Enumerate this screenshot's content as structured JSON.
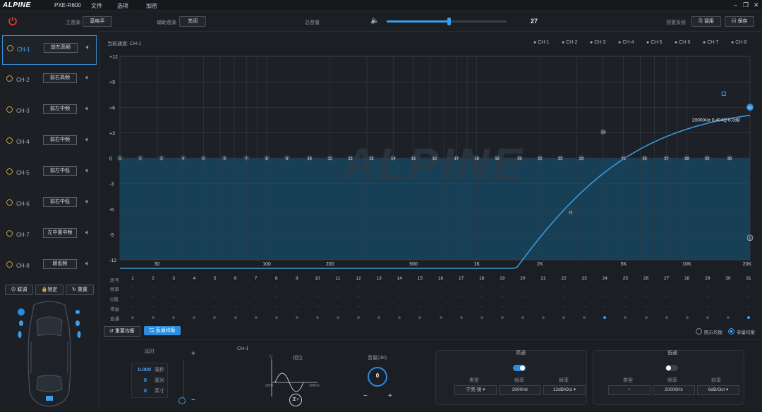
{
  "app": {
    "logo": "ALPINE",
    "model": "PXE-R600"
  },
  "menu": [
    {
      "label": "文件"
    },
    {
      "label": "选项"
    },
    {
      "label": "加密"
    }
  ],
  "toolbar": {
    "main_source_label": "主音源",
    "main_source_value": "蓝电平",
    "aux_source_label": "辅助音源",
    "aux_source_value": "关闭",
    "gain_label": "总音量",
    "gain_value": "27",
    "gain_fraction": 0.52,
    "preset_label": "预置系统",
    "recall_button": "调用",
    "save_button": "保存"
  },
  "channels": [
    {
      "id": "CH-1",
      "name": "前左高频"
    },
    {
      "id": "CH-2",
      "name": "前右高频"
    },
    {
      "id": "CH-3",
      "name": "前左中频"
    },
    {
      "id": "CH-4",
      "name": "前右中频"
    },
    {
      "id": "CH-5",
      "name": "前左中低"
    },
    {
      "id": "CH-6",
      "name": "前右中低"
    },
    {
      "id": "CH-7",
      "name": "左中置中频"
    },
    {
      "id": "CH-8",
      "name": "超低频"
    }
  ],
  "sidebar_buttons": {
    "link": "联调",
    "lock": "锁定",
    "reset": "重置"
  },
  "graph": {
    "current_channel_label": "当前通道: CH-1",
    "legend": [
      "CH-1",
      "CH-2",
      "CH-3",
      "CH-4",
      "CH-5",
      "CH-6",
      "CH-7",
      "CH-8"
    ],
    "y_ticks": [
      "+12",
      "+9",
      "+6",
      "+3",
      "0",
      "-3",
      "-6",
      "-9",
      "-12"
    ],
    "x_ticks": [
      "30",
      "100",
      "200",
      "500",
      "1K",
      "2K",
      "5K",
      "10K",
      "20K"
    ],
    "tooltip": "20000Hz  0.404Q  6.0dB",
    "watermark": "ALPINE",
    "marker_h": "H",
    "marker_l": "L"
  },
  "eq_table": {
    "row_labels": [
      "段号",
      "频率",
      "Q值",
      "增益",
      "直通"
    ],
    "bands": [
      "1",
      "2",
      "3",
      "4",
      "5",
      "6",
      "7",
      "8",
      "9",
      "10",
      "11",
      "12",
      "13",
      "14",
      "15",
      "16",
      "17",
      "18",
      "19",
      "20",
      "21",
      "22",
      "23",
      "24",
      "25",
      "26",
      "27",
      "28",
      "29",
      "30",
      "31"
    ]
  },
  "eq_buttons": {
    "restore": "重置均衡",
    "direct": "直通均衡"
  },
  "eq_mode": {
    "graphic": "图示均衡",
    "parametric": "参量均衡"
  },
  "delay": {
    "title": "延时",
    "ms_value": "0.000",
    "ms_unit": "毫秒",
    "cm_value": "0",
    "cm_unit": "厘米",
    "inch_value": "0",
    "inch_unit": "英寸",
    "plus": "+",
    "minus": "−"
  },
  "phase": {
    "channel": "CH-1",
    "title": "相位",
    "u_label": "U",
    "low": "20Hz",
    "high": "20KHz",
    "button": "正+"
  },
  "volume": {
    "title": "音量(dB)",
    "value": "0",
    "minus": "−",
    "plus": "+"
  },
  "highpass": {
    "title": "高通",
    "type_label": "类型",
    "freq_label": "频率",
    "slope_label": "斜率",
    "type_value": "宁克-锐",
    "freq_value": "3000Hz",
    "slope_value": "12dB/Oct"
  },
  "lowpass": {
    "title": "低通",
    "type_label": "类型",
    "freq_label": "频率",
    "slope_label": "斜率",
    "type_value": "",
    "freq_value": "20000Hz",
    "slope_value": "6dB/Oct"
  },
  "colors": {
    "accent": "#3a9eef",
    "curve": "#3a9ad9",
    "fill": "#1a4f6c",
    "bg": "#1b1e23"
  }
}
